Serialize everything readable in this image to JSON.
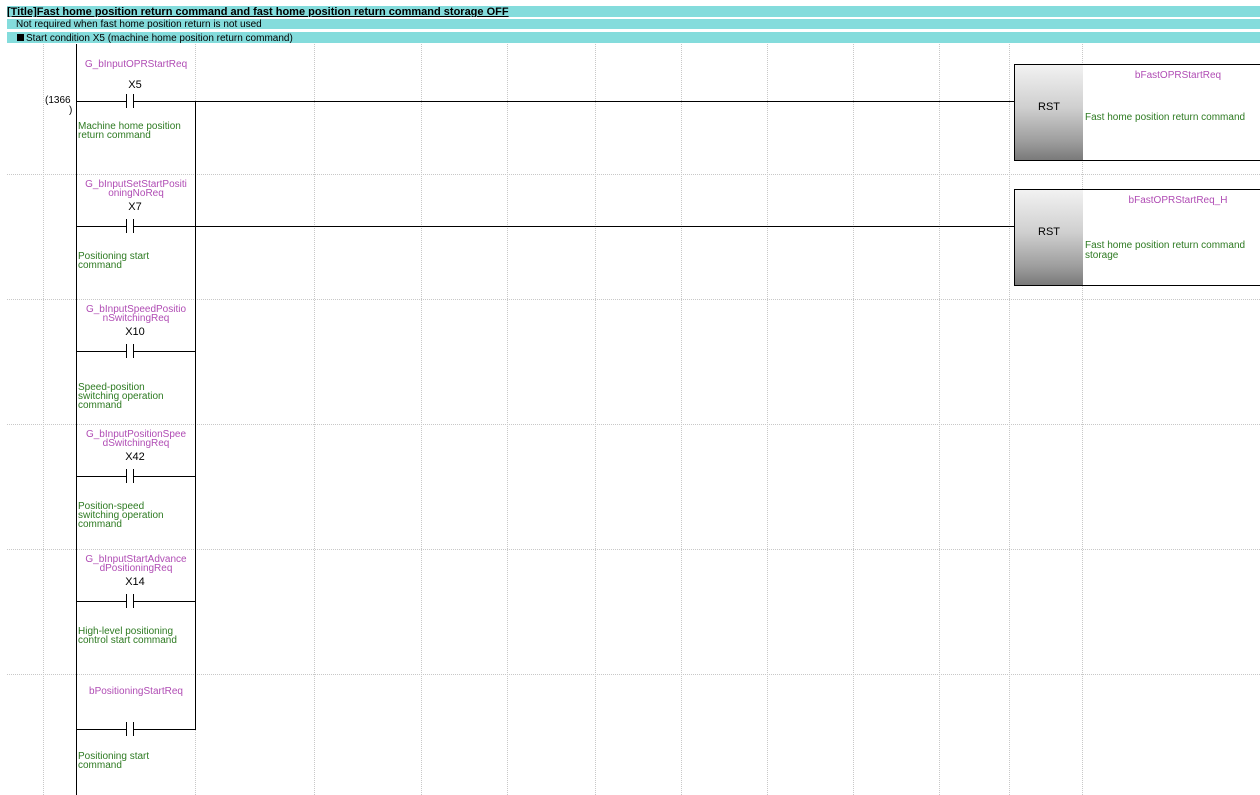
{
  "header": {
    "title_prefix": "[Title]",
    "title_main": "Fast home position return command and fast home position return command storage OFF",
    "comment": "Not required when fast home position return is not used",
    "statement": "Start condition X5 (machine home position return command)"
  },
  "rungs": [
    {
      "step": "(1366",
      "step2": ")",
      "label1": "G_bInputOPRStartReq",
      "label2": "",
      "device": "X5",
      "comment": [
        "Machine home position",
        "return command"
      ]
    },
    {
      "step": "",
      "step2": "",
      "label1": "G_bInputSetStartPositi",
      "label2": "oningNoReq",
      "device": "X7",
      "comment": [
        "Positioning start",
        "command"
      ]
    },
    {
      "step": "",
      "step2": "",
      "label1": "G_bInputSpeedPositio",
      "label2": "nSwitchingReq",
      "device": "X10",
      "comment": [
        "Speed-position",
        "switching operation",
        "command"
      ]
    },
    {
      "step": "",
      "step2": "",
      "label1": "G_bInputPositionSpee",
      "label2": "dSwitchingReq",
      "device": "X42",
      "comment": [
        "Position-speed",
        "switching operation",
        "command"
      ]
    },
    {
      "step": "",
      "step2": "",
      "label1": "G_bInputStartAdvance",
      "label2": "dPositioningReq",
      "device": "X14",
      "comment": [
        "High-level positioning",
        "control start command"
      ]
    },
    {
      "step": "",
      "step2": "",
      "label1": "bPositioningStartReq",
      "label2": "",
      "device": "",
      "comment": [
        "Positioning start",
        "command"
      ]
    }
  ],
  "coils": [
    {
      "instruction": "RST",
      "operand_label": "bFastOPRStartReq",
      "operand_comment": [
        "Fast home position return command"
      ]
    },
    {
      "instruction": "RST",
      "operand_label": "bFastOPRStartReq_H",
      "operand_comment": [
        "Fast home position return command",
        "storage"
      ]
    }
  ]
}
